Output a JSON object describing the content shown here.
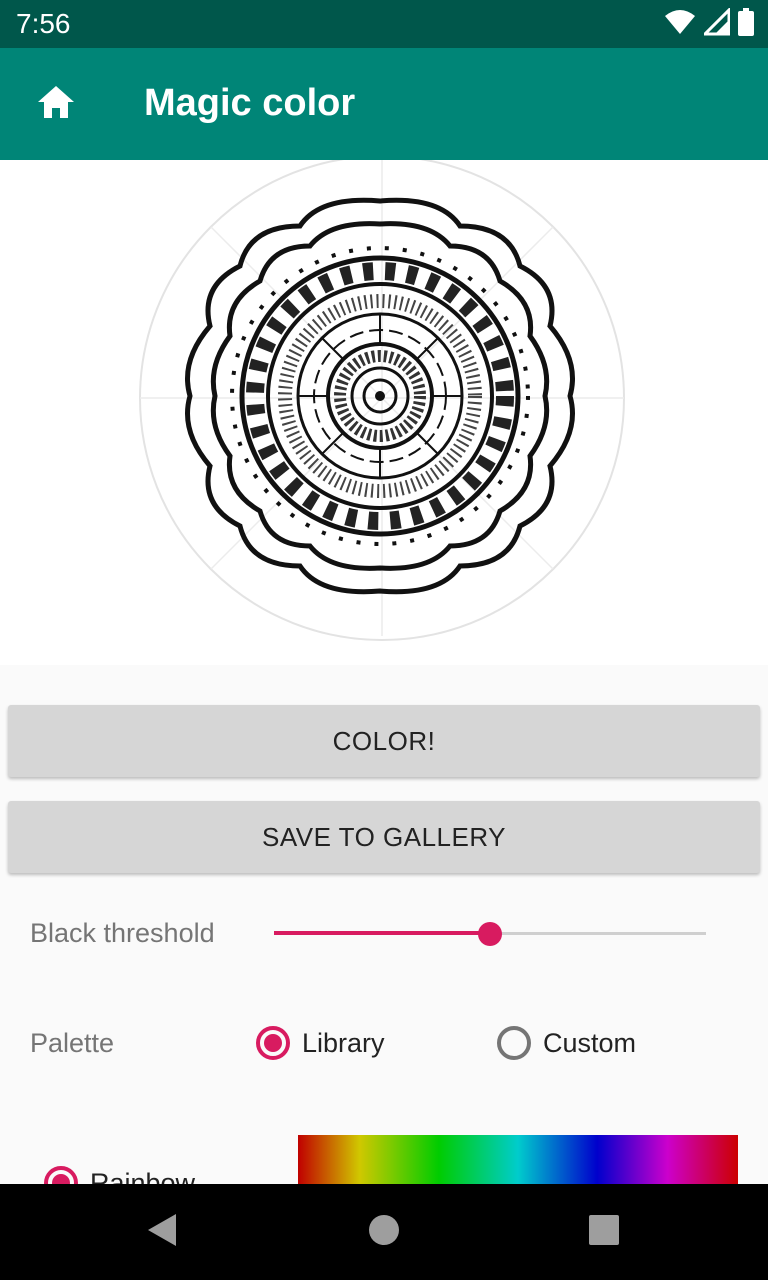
{
  "status_bar": {
    "time": "7:56",
    "icons": [
      "wifi-icon",
      "signal-icon",
      "battery-icon"
    ]
  },
  "app_bar": {
    "title": "Magic color",
    "home_icon": "home-icon",
    "background": "#008577"
  },
  "image": {
    "description_icon": "mandala-drawing"
  },
  "buttons": {
    "color_label": "COLOR!",
    "save_label": "SAVE TO GALLERY"
  },
  "threshold": {
    "label": "Black threshold",
    "value_fraction": 0.5
  },
  "palette": {
    "label": "Palette",
    "options": [
      {
        "label": "Library",
        "checked": true
      },
      {
        "label": "Custom",
        "checked": false
      }
    ],
    "library_items": [
      {
        "label": "Rainbow",
        "checked": true
      }
    ]
  },
  "colors": {
    "accent": "#d81b60",
    "primary": "#008577",
    "primary_dark": "#00574b"
  },
  "nav_bar": {
    "icons": [
      "back-icon",
      "home-circle-icon",
      "recents-icon"
    ]
  }
}
